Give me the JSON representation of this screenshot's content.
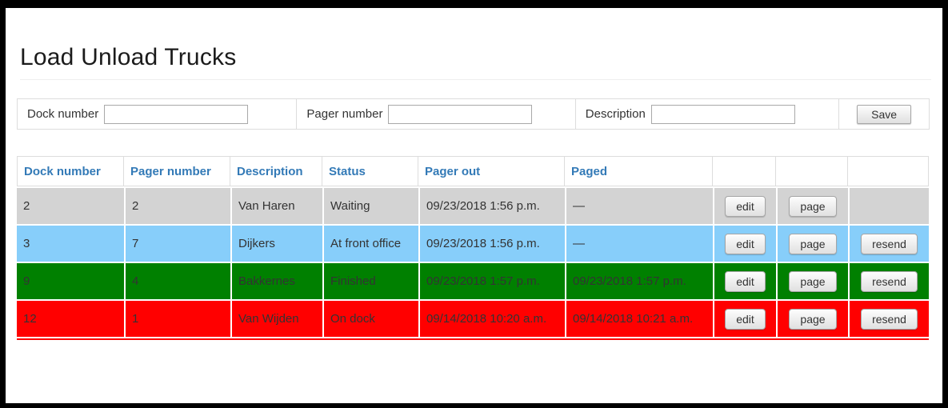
{
  "page": {
    "title": "Load Unload Trucks"
  },
  "form": {
    "fields": [
      {
        "name": "dock_number",
        "label": "Dock number",
        "value": ""
      },
      {
        "name": "pager_number",
        "label": "Pager number",
        "value": ""
      },
      {
        "name": "description",
        "label": "Description",
        "value": ""
      }
    ],
    "save_button": "Save"
  },
  "table": {
    "headers": [
      "Dock number",
      "Pager number",
      "Description",
      "Status",
      "Pager out",
      "Paged",
      "",
      "",
      ""
    ],
    "header_text_color": "#337ab7",
    "action_labels": {
      "edit": "edit",
      "page": "page",
      "resend": "resend"
    },
    "rows": [
      {
        "dock_number": "2",
        "pager_number": "2",
        "description": "Van Haren",
        "status": "Waiting",
        "pager_out": "09/23/2018 1:56 p.m.",
        "paged": "—",
        "row_color": "#d3d3d3",
        "actions": [
          "edit",
          "page"
        ]
      },
      {
        "dock_number": "3",
        "pager_number": "7",
        "description": "Dijkers",
        "status": "At front office",
        "pager_out": "09/23/2018 1:56 p.m.",
        "paged": "—",
        "row_color": "#87cefa",
        "actions": [
          "edit",
          "page",
          "resend"
        ]
      },
      {
        "dock_number": "9",
        "pager_number": "4",
        "description": "Bakkernes",
        "status": "Finished",
        "pager_out": "09/23/2018 1:57 p.m.",
        "paged": "09/23/2018 1:57 p.m.",
        "row_color": "#008000",
        "actions": [
          "edit",
          "page",
          "resend"
        ]
      },
      {
        "dock_number": "12",
        "pager_number": "1",
        "description": "Van Wijden",
        "status": "On dock",
        "pager_out": "09/14/2018 10:20 a.m.",
        "paged": "09/14/2018 10:21 a.m.",
        "row_color": "#ff0000",
        "actions": [
          "edit",
          "page",
          "resend"
        ]
      }
    ]
  }
}
